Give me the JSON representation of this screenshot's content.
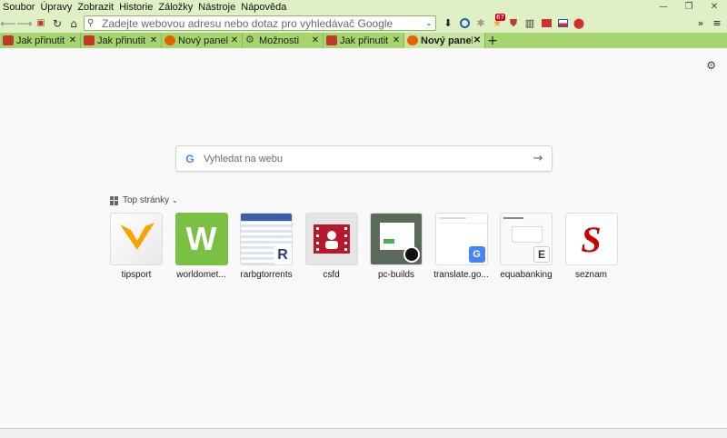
{
  "menu": [
    "Soubor",
    "Úpravy",
    "Zobrazit",
    "Historie",
    "Záložky",
    "Nástroje",
    "Nápověda"
  ],
  "window_controls": [
    "—",
    "❐",
    "✕"
  ],
  "urlbar": {
    "placeholder": "Zadejte webovou adresu nebo dotaz pro vyhledávač Google"
  },
  "toolbar": {
    "badge": "67"
  },
  "tabs": [
    {
      "label": "Jak přinutit",
      "favicon_color": "#c0392b",
      "active": false
    },
    {
      "label": "Jak přinutit",
      "favicon_color": "#c0392b",
      "active": false
    },
    {
      "label": "Nový panel",
      "favicon_color": "#e66000",
      "active": false
    },
    {
      "label": "Možnosti",
      "favicon_color": "#555555",
      "active": false
    },
    {
      "label": "Jak přinutit",
      "favicon_color": "#c0392b",
      "active": false
    },
    {
      "label": "Nový panel",
      "favicon_color": "#e66000",
      "active": true
    }
  ],
  "search": {
    "placeholder": "Vyhledat na webu"
  },
  "top_sites": {
    "heading": "Top stránky",
    "sites": [
      {
        "label": "tipsport",
        "color": "#f7a400",
        "logo_text": "",
        "corner": ""
      },
      {
        "label": "worldomet...",
        "color": "#7ac143",
        "logo_text": "W",
        "corner": ""
      },
      {
        "label": "rarbgtorrents",
        "color": "#3a5fa8",
        "logo_text": "",
        "corner": "R"
      },
      {
        "label": "csfd",
        "color": "#b7182c",
        "logo_text": "",
        "corner": ""
      },
      {
        "label": "pc-builds",
        "color": "#4a7a4a",
        "logo_text": "",
        "corner": ""
      },
      {
        "label": "translate.go...",
        "color": "#4285f4",
        "logo_text": "",
        "corner": "G"
      },
      {
        "label": "equabanking",
        "color": "#1e88e5",
        "logo_text": "",
        "corner": "E"
      },
      {
        "label": "seznam",
        "color": "#cc0000",
        "logo_text": "S",
        "corner": ""
      }
    ]
  }
}
